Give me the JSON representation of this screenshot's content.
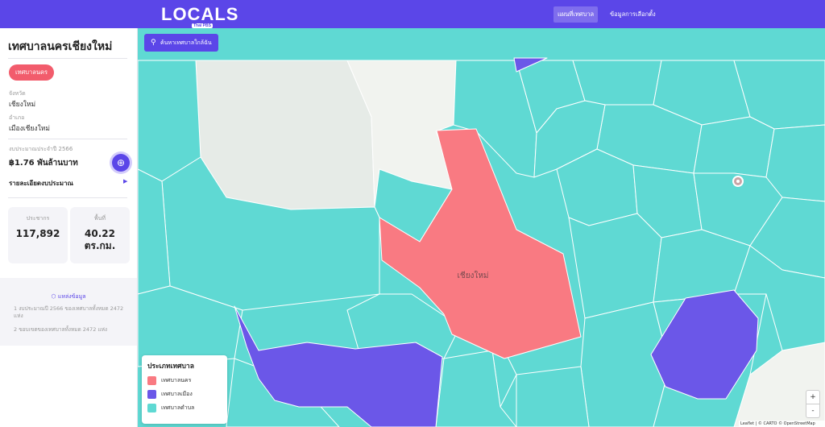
{
  "header": {
    "logo_text": "LOCALS",
    "logo_tag": "Thai PBS",
    "nav": [
      {
        "label": "แผนที่เทศบาล",
        "active": true
      },
      {
        "label": "ข้อมูลการเลือกตั้ง",
        "active": false
      }
    ]
  },
  "sidebar": {
    "title": "เทศบาลนครเชียงใหม่",
    "badge": "เทศบาลนคร",
    "province_label": "จังหวัด",
    "province": "เชียงใหม่",
    "district_label": "อำเภอ",
    "district": "เมืองเชียงใหม่",
    "budget_label": "งบประมาณประจำปี 2566",
    "budget_value": "฿1.76 พันล้านบาท",
    "detail_label": "รายละเอียดงบประมาณ",
    "population_label": "ประชากร",
    "population": "117,892",
    "area_label": "พื้นที่",
    "area_value": "40.22",
    "area_unit": "ตร.กม.",
    "source_title": "แหล่งข้อมูล",
    "sources": [
      "1 งบประมาณปี 2566 ของเทศบาลทั้งหมด 2472 แห่ง",
      "2 ขอบเขตของเทศบาลทั้งหมด 2472 แห่ง"
    ]
  },
  "map": {
    "search_button": "ค้นหาเทศบาลใกล้ฉัน",
    "city_label": "เชียงใหม่",
    "legend_title": "ประเภทเทศบาล",
    "legend": [
      {
        "label": "เทศบาลนคร",
        "color": "#f97a82"
      },
      {
        "label": "เทศบาลเมือง",
        "color": "#6b57e8"
      },
      {
        "label": "เทศบาลตำบล",
        "color": "#5fd9d3"
      }
    ],
    "zoom_in": "+",
    "zoom_out": "-",
    "attribution": "Leaflet | © CARTO © OpenStreetMap",
    "colors": {
      "city": "#f97a82",
      "town": "#6b57e8",
      "subdistrict": "#5fd9d3",
      "base": "#f3f4f1",
      "unincorporated": "#e6ebe7"
    }
  }
}
